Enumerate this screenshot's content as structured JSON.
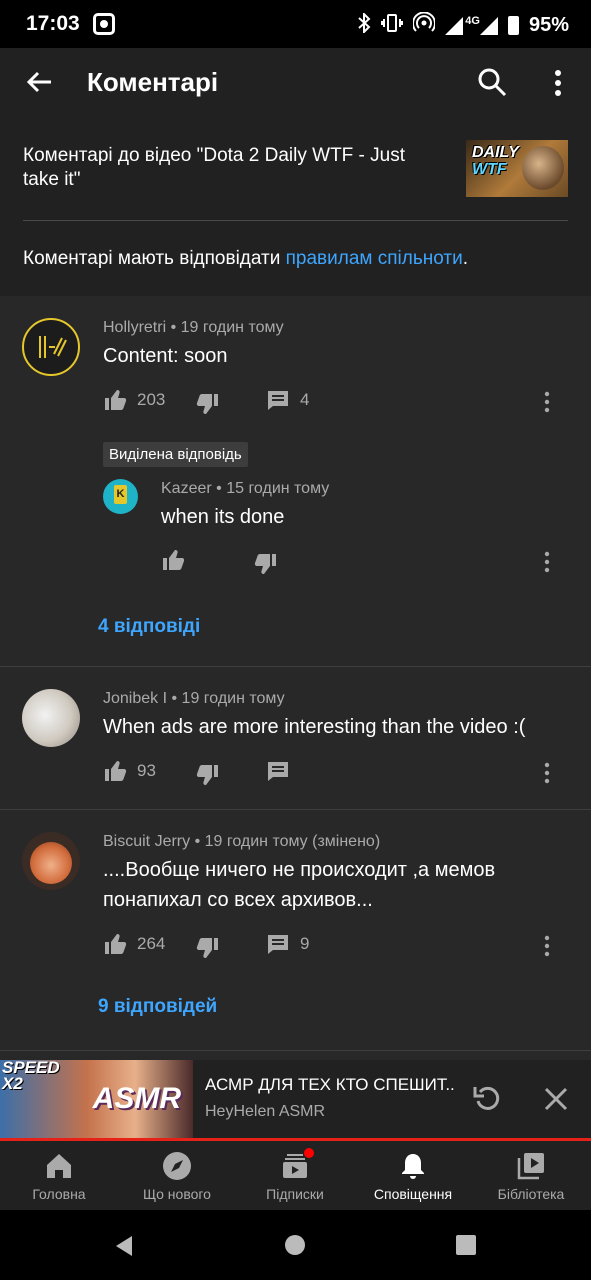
{
  "status": {
    "time": "17:03",
    "network": "4G",
    "battery": "95%"
  },
  "appbar": {
    "title": "Коментарі"
  },
  "header": {
    "video_title": "Коментарі до відео \"Dota 2 Daily WTF - Just take it\"",
    "thumb_line1": "DAILY",
    "thumb_line2": "WTF",
    "rules_prefix": "Коментарі мають відповідати ",
    "rules_link": "правилам спільноти",
    "rules_suffix": "."
  },
  "comments": [
    {
      "author": "Hollyretri",
      "time": "19 годин тому",
      "text": "Content: soon",
      "likes": "203",
      "replies_count": "4",
      "highlight_label": "Виділена відповідь",
      "reply": {
        "author": "Kazeer",
        "time": "15 годин тому",
        "text": "when its done"
      },
      "replies_link": "4 відповіді"
    },
    {
      "author": "Jonibek I",
      "time": "19 годин тому",
      "text": "When ads are more interesting than the video :(",
      "likes": "93"
    },
    {
      "author": "Biscuit Jerry",
      "time": "19 годин тому (змінено)",
      "text_line1": "....Вообще ничего не происходит ,а мемов",
      "text_line2": "понапихал со всех архивов...",
      "likes": "264",
      "replies_count": "9",
      "replies_link": "9 відповідей"
    }
  ],
  "miniplayer": {
    "title": "АСМР ДЛЯ ТЕХ КТО СПЕШИТ..",
    "channel": "HeyHelen ASMR",
    "thumb_speed": "SPEED",
    "thumb_x2": "X2",
    "thumb_asmr": "ASMR"
  },
  "nav": {
    "items": [
      {
        "label": "Головна",
        "icon": "home-icon"
      },
      {
        "label": "Що нового",
        "icon": "explore-icon"
      },
      {
        "label": "Підписки",
        "icon": "subscriptions-icon"
      },
      {
        "label": "Сповіщення",
        "icon": "bell-icon"
      },
      {
        "label": "Бібліотека",
        "icon": "library-icon"
      }
    ],
    "active": "Сповіщення"
  },
  "colors": {
    "accent_link": "#3ea6ff",
    "progress": "#e62117",
    "surface": "#282828",
    "bar": "#212121"
  }
}
